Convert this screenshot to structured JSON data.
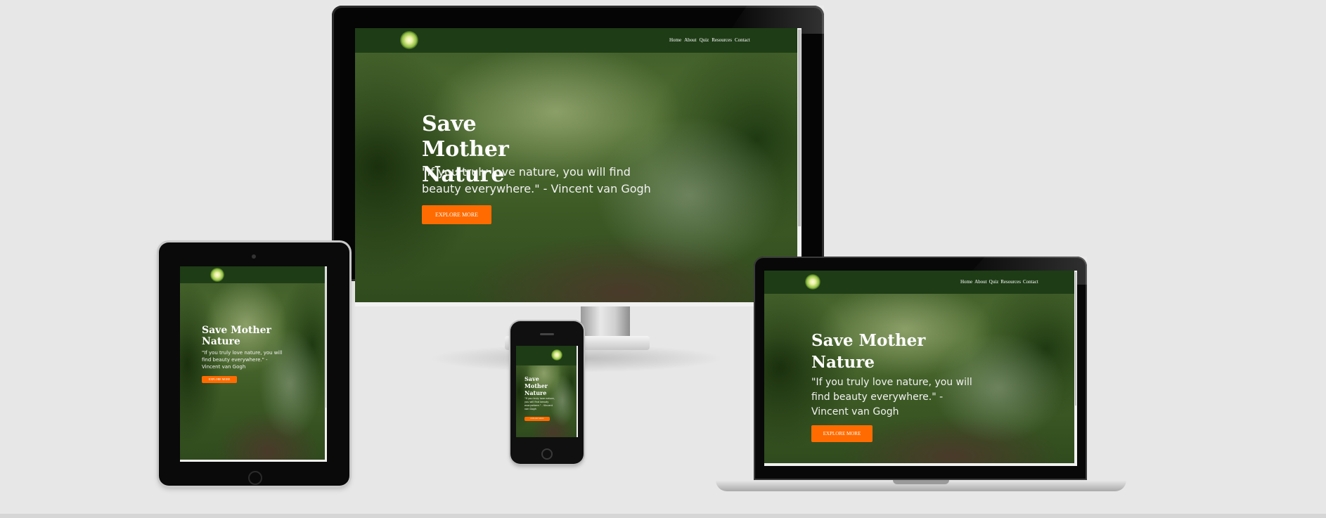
{
  "site": {
    "nav_items": [
      "Home",
      "About",
      "Quiz",
      "Resources",
      "Contact"
    ],
    "hero_title": "Save Mother Nature",
    "hero_quote": "\"If you truly love nature, you will find beauty everywhere.\" - Vincent van Gogh",
    "cta_label": "EXPLORE MORE"
  },
  "colors": {
    "nav_bg": "#1e3c16",
    "cta_bg": "#ff6b00",
    "page_bg": "#e7e7e7"
  },
  "icons": {
    "logo": "glowing-earth-logo"
  }
}
